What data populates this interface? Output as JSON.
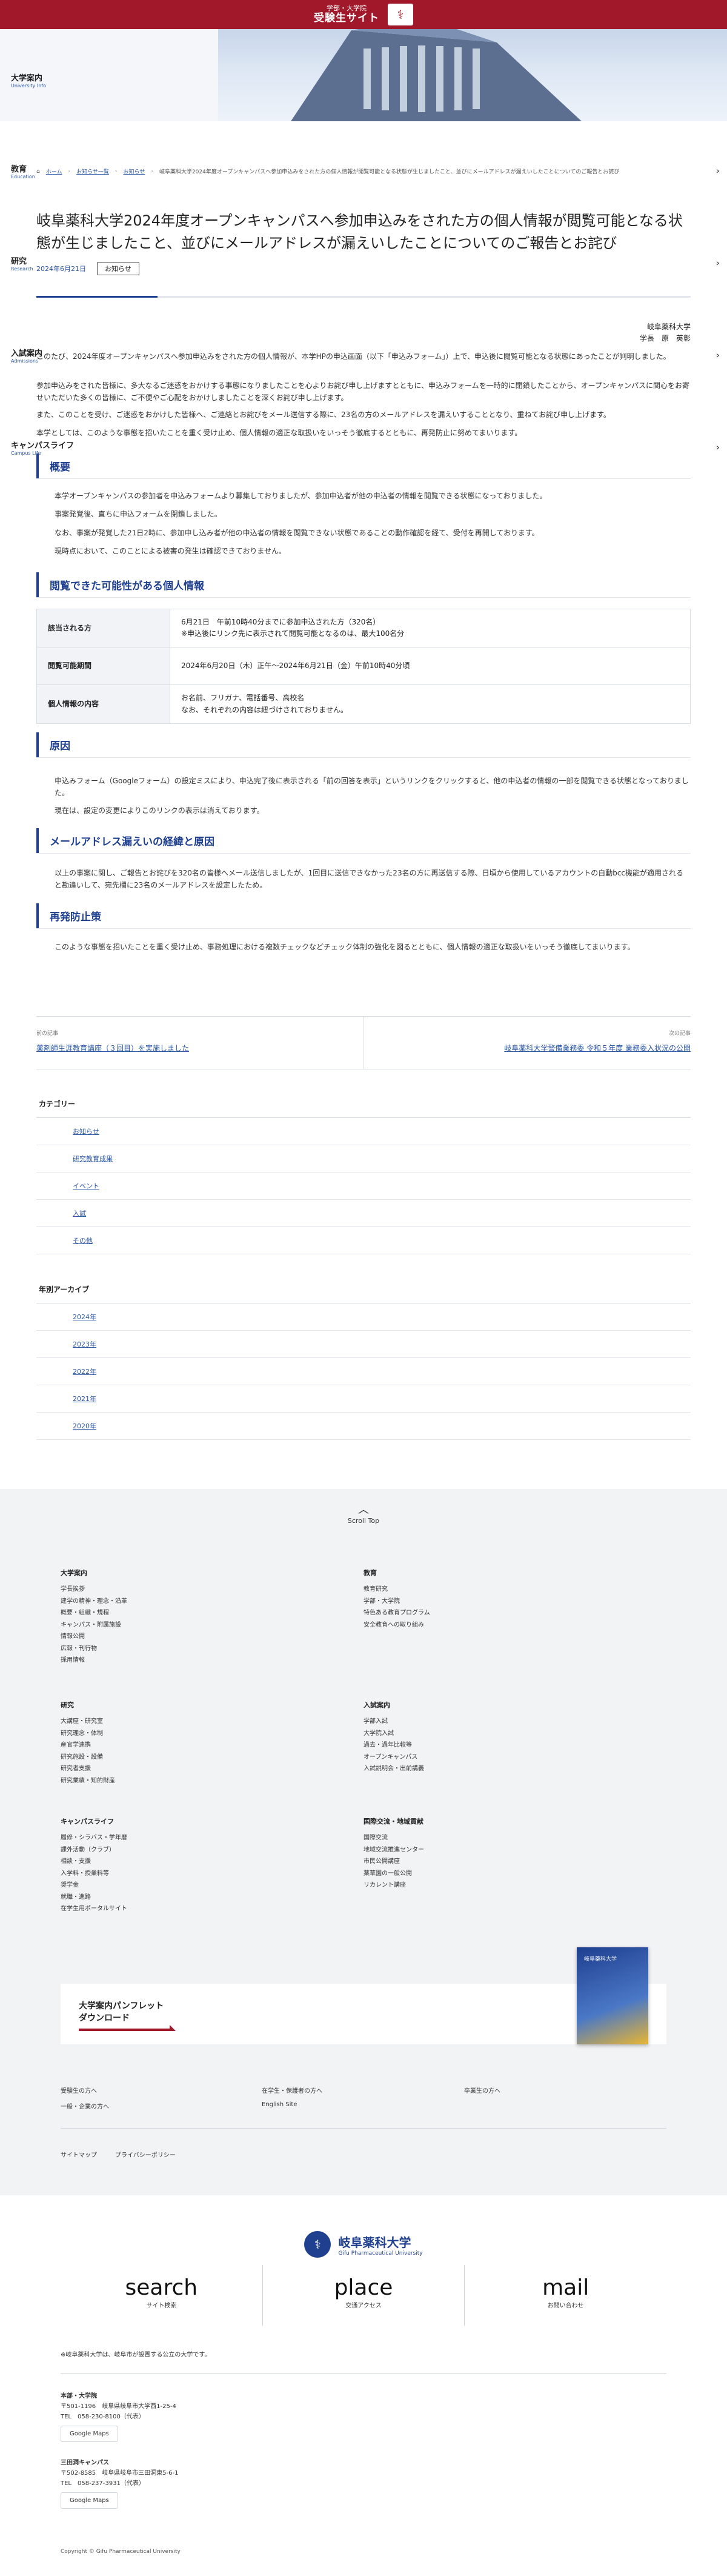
{
  "site": {
    "banner_small": "学部・大学院",
    "banner_big": "受験生サイト",
    "hero_jp": "大学案内",
    "hero_en": "University Info"
  },
  "side_nav": [
    {
      "jp": "教育",
      "en": "Education"
    },
    {
      "jp": "研究",
      "en": "Research"
    },
    {
      "jp": "入試案内",
      "en": "Admissions"
    },
    {
      "jp": "キャンパスライフ",
      "en": "Campus Life"
    }
  ],
  "breadcrumb": [
    "ホーム",
    "お知らせ一覧",
    "お知らせ",
    "岐阜薬科大学2024年度オープンキャンパスへ参加申込みをされた方の個人情報が閲覧可能となる状態が生じましたこと、並びにメールアドレスが漏えいしたことについてのご報告とお詫び"
  ],
  "article": {
    "title": "岐阜薬科大学2024年度オープンキャンパスへ参加申込みをされた方の個人情報が閲覧可能となる状態が生じましたこと、並びにメールアドレスが漏えいしたことについてのご報告とお詫び",
    "date": "2024年6月21日",
    "category": "お知らせ",
    "signature": [
      "岐阜薬科大学",
      "学長　原　英彰"
    ],
    "intro": [
      "このたび、2024年度オープンキャンパスへ参加申込みをされた方の個人情報が、本学HPの申込画面（以下「申込みフォーム」）上で、申込後に閲覧可能となる状態にあったことが判明しました。",
      "参加申込みをされた皆様に、多大なるご迷惑をおかけする事態になりましたことを心よりお詫び申し上げますとともに、申込みフォームを一時的に閉鎖したことから、オープンキャンパスに関心をお寄せいただいた多くの皆様に、ご不便やご心配をおかけしましたことを深くお詫び申し上げます。",
      "また、このことを受け、ご迷惑をおかけした皆様へ、ご連絡とお詫びをメール送信する際に、23名の方のメールアドレスを漏えいすることとなり、重ねてお詫び申し上げます。",
      "本学としては、このような事態を招いたことを重く受け止め、個人情報の適正な取扱いをいっそう徹底するとともに、再発防止に努めてまいります。"
    ],
    "s1_title": "概要",
    "s1_body": [
      "本学オープンキャンパスの参加者を申込みフォームより募集しておりましたが、参加申込者が他の申込者の情報を閲覧できる状態になっておりました。",
      "事案発覚後、直ちに申込フォームを閉鎖しました。",
      "なお、事案が発覚した21日2時に、参加申し込み者が他の申込者の情報を閲覧できない状態であることの動作確認を経て、受付を再開しております。",
      "現時点において、このことによる被害の発生は確認できておりません。"
    ],
    "s2_title": "閲覧できた可能性がある個人情報",
    "table": [
      {
        "h": "該当される方",
        "v": [
          "6月21日　午前10時40分までに参加申込された方（320名）",
          "※申込後にリンク先に表示されて閲覧可能となるのは、最大100名分"
        ]
      },
      {
        "h": "閲覧可能期間",
        "v": [
          "2024年6月20日（木）正午〜2024年6月21日（金）午前10時40分頃"
        ]
      },
      {
        "h": "個人情報の内容",
        "v": [
          "お名前、フリガナ、電話番号、高校名",
          "なお、それぞれの内容は紐づけされておりません。"
        ]
      }
    ],
    "s3_title": "原因",
    "s3_body": [
      "申込みフォーム（Googleフォーム）の設定ミスにより、申込完了後に表示される「前の回答を表示」というリンクをクリックすると、他の申込者の情報の一部を閲覧できる状態となっておりました。",
      "現在は、設定の変更によりこのリンクの表示は消えております。"
    ],
    "s4_title": "メールアドレス漏えいの経緯と原因",
    "s4_body": [
      "以上の事案に関し、ご報告とお詫びを320名の皆様へメール送信しましたが、1回目に送信できなかった23名の方に再送信する際、日頃から使用しているアカウントの自動bcc機能が適用されると勘違いして、宛先欄に23名のメールアドレスを設定したため。"
    ],
    "s5_title": "再発防止策",
    "s5_body": [
      "このような事態を招いたことを重く受け止め、事務処理における複数チェックなどチェック体制の強化を図るとともに、個人情報の適正な取扱いをいっそう徹底してまいります。"
    ]
  },
  "pager": {
    "prev_label": "前の記事",
    "prev_title": "薬剤師生涯教育講座（３回目）を実施しました",
    "next_label": "次の記事",
    "next_title": "岐阜薬科大学警備業務委 令和５年度 業務委入状況の公開"
  },
  "categories": {
    "title": "カテゴリー",
    "items": [
      "お知らせ",
      "研究教育成果",
      "イベント",
      "入試",
      "その他"
    ]
  },
  "archive": {
    "title": "年別アーカイブ",
    "items": [
      "2024年",
      "2023年",
      "2022年",
      "2021年",
      "2020年"
    ]
  },
  "scroll_top": "Scroll Top",
  "footer_nav": [
    {
      "h": "大学案内",
      "items": [
        "学長挨拶",
        "建学の精神・理念・沿革",
        "概要・組織・規程",
        "キャンパス・附属施設",
        "情報公開",
        "広報・刊行物",
        "採用情報"
      ]
    },
    {
      "h": "教育",
      "items": [
        "教育研究",
        "学部・大学院",
        "特色ある教育プログラム",
        "安全教育への取り組み"
      ]
    },
    {
      "h": "研究",
      "items": [
        "大講座・研究室",
        "研究理念・体制",
        "産官学連携",
        "研究施設・設備",
        "研究者支援",
        "研究業績・知的財産"
      ]
    },
    {
      "h": "入試案内",
      "items": [
        "学部入試",
        "大学院入試",
        "過去・過年比較等",
        "オープンキャンパス",
        "入試説明会・出前講義"
      ]
    },
    {
      "h": "キャンパスライフ",
      "items": [
        "履修・シラバス・学年暦",
        "課外活動（クラブ）",
        "相談・支援",
        "入学料・授業料等",
        "奨学金",
        "就職・進路",
        "在学生用ポータルサイト"
      ]
    },
    {
      "h": "国際交流・地域貢献",
      "items": [
        "国際交流",
        "地域交流推進センター",
        "市民公開講座",
        "薬草園の一般公開",
        "リカレント講座"
      ]
    }
  ],
  "pamphlet": {
    "line1": "大学案内パンフレット",
    "line2": "ダウンロード",
    "book_label": "岐阜薬科大学"
  },
  "audience_links": [
    [
      "受験生の方へ",
      "在学生・保護者の方へ",
      "卒業生の方へ"
    ],
    [
      "一般・企業の方へ",
      "English Site"
    ]
  ],
  "legal_links": [
    "サイトマップ",
    "プライバシーポリシー"
  ],
  "logo": {
    "jp": "岐阜薬科大学",
    "en": "Gifu Pharmaceutical University"
  },
  "quick_links": [
    {
      "en": "search",
      "jp": "サイト検索"
    },
    {
      "en": "place",
      "jp": "交通アクセス"
    },
    {
      "en": "mail",
      "jp": "お問い合わせ"
    }
  ],
  "note": "※岐阜薬科大学は、岐阜市が設置する公立の大学です。",
  "addresses": [
    {
      "h": "本部・大学院",
      "lines": [
        "〒501-1196　岐阜県岐阜市大学西1-25-4",
        "TEL　058-230-8100（代表）"
      ],
      "map": "Google Maps"
    },
    {
      "h": "三田洞キャンパス",
      "lines": [
        "〒502-8585　岐阜県岐阜市三田洞東5-6-1",
        "TEL　058-237-3931（代表）"
      ],
      "map": "Google Maps"
    }
  ],
  "copyright": "Copyright © Gifu Pharmaceutical University"
}
